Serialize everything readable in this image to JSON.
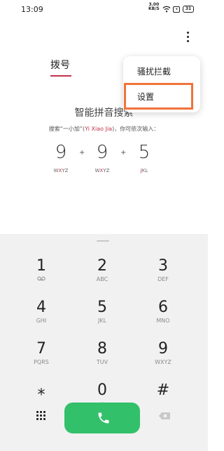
{
  "status_bar": {
    "time": "13:09",
    "speed_value": "3.00",
    "speed_unit": "KB/S",
    "battery": "31"
  },
  "dial_tab": {
    "label": "拨号"
  },
  "menu": {
    "items": [
      "骚扰拦截",
      "设置"
    ]
  },
  "smart_search": {
    "title": "智能拼音搜索",
    "desc_prefix": "搜索“一小加”(",
    "desc_highlight": "Yi Xiao Jia",
    "desc_suffix": ")，你可依次输入："
  },
  "example": {
    "digits": [
      "9",
      "9",
      "5"
    ],
    "letters_1": {
      "pre": "W",
      "hl": "X",
      "post": "YZ"
    },
    "letters_2": {
      "pre": "W",
      "hl": "X",
      "post": "YZ"
    },
    "letters_3": {
      "pre": "",
      "hl": "J",
      "post": "KL"
    },
    "plus": "+"
  },
  "keypad": {
    "keys": [
      {
        "digit": "1",
        "letters": ""
      },
      {
        "digit": "2",
        "letters": "ABC"
      },
      {
        "digit": "3",
        "letters": "DEF"
      },
      {
        "digit": "4",
        "letters": "GHI"
      },
      {
        "digit": "5",
        "letters": "JKL"
      },
      {
        "digit": "6",
        "letters": "MNO"
      },
      {
        "digit": "7",
        "letters": "PQRS"
      },
      {
        "digit": "8",
        "letters": "TUV"
      },
      {
        "digit": "9",
        "letters": "WXYZ"
      },
      {
        "digit": "⁎",
        "letters": ""
      },
      {
        "digit": "0",
        "letters": "+"
      },
      {
        "digit": "#",
        "letters": ""
      }
    ]
  },
  "colors": {
    "accent": "#c2334a",
    "highlight_box": "#f0733a",
    "call_button": "#33c06a",
    "keypad_bg": "#f1f1f1"
  }
}
